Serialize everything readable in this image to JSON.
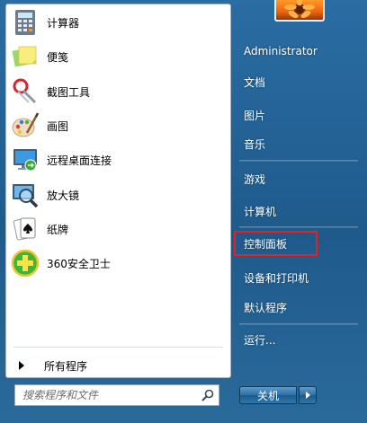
{
  "programs": [
    {
      "label": "计算器",
      "icon": "calculator-icon"
    },
    {
      "label": "便笺",
      "icon": "sticky-notes-icon"
    },
    {
      "label": "截图工具",
      "icon": "snipping-tool-icon"
    },
    {
      "label": "画图",
      "icon": "paint-icon"
    },
    {
      "label": "远程桌面连接",
      "icon": "remote-desktop-icon"
    },
    {
      "label": "放大镜",
      "icon": "magnifier-icon"
    },
    {
      "label": "纸牌",
      "icon": "solitaire-icon"
    },
    {
      "label": "360安全卫士",
      "icon": "security-guard-icon"
    }
  ],
  "all_programs": {
    "label": "所有程序"
  },
  "search": {
    "placeholder": "搜索程序和文件"
  },
  "right": {
    "user": "Administrator",
    "items": [
      {
        "label": "文档"
      },
      {
        "label": "图片"
      },
      {
        "label": "音乐"
      },
      {
        "label": "游戏"
      },
      {
        "label": "计算机"
      },
      {
        "label": "控制面板"
      },
      {
        "label": "设备和打印机"
      },
      {
        "label": "默认程序"
      },
      {
        "label": "运行..."
      }
    ]
  },
  "shutdown": {
    "label": "关机"
  },
  "colors": {
    "highlight_box": "#e8211b",
    "menu_blue": "#2a6da3"
  }
}
